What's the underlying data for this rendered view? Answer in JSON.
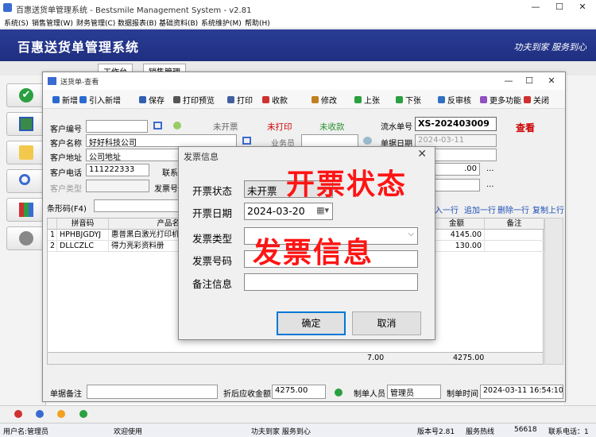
{
  "app": {
    "title": "百惠送货单管理系统 - Bestsmile Management System - v2.81",
    "menu": [
      "系统(S)",
      "销售管理(W)",
      "财务管理(C)",
      "数据报表(B)",
      "基础资料(B)",
      "系统维护(M)",
      "帮助(H)"
    ],
    "banner_title": "百惠送货单管理系统",
    "banner_slogan": "功夫到家 服务到心",
    "tabs": [
      "工作台",
      "销售管理"
    ],
    "status": {
      "user": "用户名:管理员",
      "welcome": "欢迎使用",
      "slogan": "功夫到家 服务到心",
      "version": "版本号2.81",
      "service_label": "服务热线",
      "service_num": "56618",
      "service_tel": "联系电话：1"
    }
  },
  "win": {
    "title": "送货单-查看",
    "toolbar": [
      "新增",
      "引入新增",
      "保存",
      "打印预览",
      "打印",
      "收款",
      "修改",
      "上张",
      "下张",
      "反审核",
      "更多功能",
      "关闭"
    ],
    "toolbar_colors": [
      "#2a6ad0",
      "#2a6ad0",
      "#3060b0",
      "#555",
      "#4060a0",
      "#d03030",
      "#c08020",
      "#2aa040",
      "#2aa040",
      "#3070c0",
      "#9050c0",
      "#d03030"
    ],
    "form": {
      "cust_no_label": "客户编号",
      "cust_name_label": "客户名称",
      "cust_name": "好好科技公司",
      "cust_addr_label": "客户地址",
      "cust_addr": "公司地址",
      "cust_tel_label": "客户电话",
      "cust_tel": "111222333",
      "contact_label": "联系人",
      "cust_type_label": "客户类型",
      "invoice_no_label": "发票号码",
      "status_invoice": "未开票",
      "status_print": "未打印",
      "status_pay": "未收款",
      "salesman_label": "业务员",
      "serial_label": "流水单号",
      "serial": "XS-202403009",
      "date_label": "单据日期",
      "date": "2024-03-11",
      "view_label": "查看",
      "field1_value": ".00",
      "barcode_label": "条形码(F4)",
      "ellipsis": "..."
    },
    "grid_actions": [
      "入一行",
      "追加一行",
      "删除一行",
      "复制上行"
    ],
    "grid": {
      "headers": [
        "拼音码",
        "产品名称",
        "金额",
        "备注"
      ],
      "rows": [
        {
          "no": "1",
          "code": "HPHBJGDYJ",
          "name": "惠普黑白激光打印机",
          "amount": "4145.00"
        },
        {
          "no": "2",
          "code": "DLLCZLC",
          "name": "得力亮彩资料册",
          "amount": "130.00"
        }
      ],
      "total_qty": "7.00",
      "total_amount": "4275.00"
    },
    "footer": {
      "remark_label": "单据备注",
      "discount_label": "折后应收金额",
      "discount": "4275.00",
      "maker_label": "制单人员",
      "maker": "管理员",
      "time_label": "制单时间",
      "time": "2024-03-11 16:54:10"
    }
  },
  "dialog": {
    "title": "发票信息",
    "status_label": "开票状态",
    "status_value": "未开票",
    "date_label": "开票日期",
    "date_value": "2024-03-20",
    "type_label": "发票类型",
    "number_label": "发票号码",
    "remark_label": "备注信息",
    "ok": "确定",
    "cancel": "取消"
  },
  "overlays": {
    "status": "开票状态",
    "info": "发票信息"
  }
}
